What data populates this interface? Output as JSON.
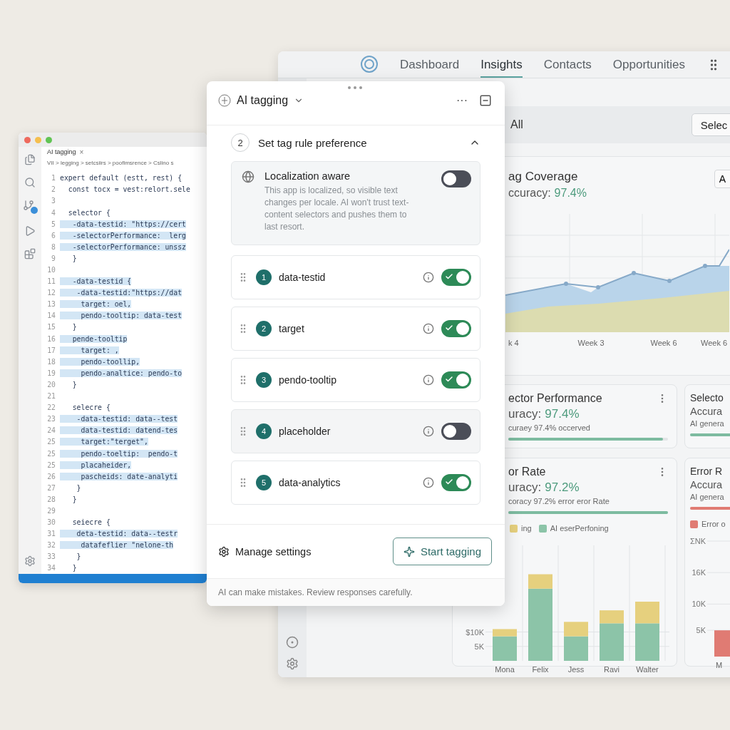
{
  "editor": {
    "tab": "AI tagging",
    "tab_close": "×",
    "breadcrumb": "VII > legging > setcsiirs > poofimsrence > Cslino s",
    "lines": [
      {
        "number": "1",
        "text": "expert default (estt, rest) {",
        "highlighted": false
      },
      {
        "number": "2",
        "text": "  const tocx = vest:relort.sele",
        "highlighted": false
      },
      {
        "number": "3",
        "highlighted": false
      },
      {
        "number": "4",
        "text": "  selector {",
        "highlighted": false
      },
      {
        "number": "5",
        "text": "   -data-testid: \"https://cert",
        "highlighted": true
      },
      {
        "number": "6",
        "text": "   -selectorPerformance:  lerg",
        "highlighted": true
      },
      {
        "number": "8",
        "text": "   -selectorPerformance: unssz",
        "highlighted": true
      },
      {
        "number": "9",
        "text": "   }",
        "highlighted": false
      },
      {
        "number": "10",
        "highlighted": false
      },
      {
        "number": "11",
        "text": "   -data-testid {",
        "highlighted": true
      },
      {
        "number": "12",
        "text": "    -data-testid:\"https://dat",
        "highlighted": true
      },
      {
        "number": "13",
        "text": "     target: oel,",
        "highlighted": true
      },
      {
        "number": "14",
        "text": "     pendo-tooltip: data-test",
        "highlighted": true
      },
      {
        "number": "15",
        "text": "   }",
        "highlighted": false
      },
      {
        "number": "16",
        "text": "   pende-tooltip",
        "highlighted": true
      },
      {
        "number": "17",
        "text": "     target: ,",
        "highlighted": true
      },
      {
        "number": "18",
        "text": "     pendo-toollip,",
        "highlighted": true
      },
      {
        "number": "19",
        "text": "     pendo-analtice: pendo-to",
        "highlighted": true
      },
      {
        "number": "20",
        "text": "   }",
        "highlighted": false
      },
      {
        "number": "21",
        "highlighted": false
      },
      {
        "number": "22",
        "text": "   selecre {",
        "highlighted": false
      },
      {
        "number": "23",
        "text": "    -data-testid: data--test",
        "highlighted": true
      },
      {
        "number": "24",
        "text": "     data-testid: datend-tes",
        "highlighted": true
      },
      {
        "number": "25",
        "text": "     target:\"terget\",",
        "highlighted": true
      },
      {
        "number": "25",
        "text": "     pendo-toeltip:  pendo-t",
        "highlighted": true
      },
      {
        "number": "25",
        "text": "     placaheider,",
        "highlighted": true
      },
      {
        "number": "26",
        "text": "     pascheids: date-analyti",
        "highlighted": true
      },
      {
        "number": "27",
        "text": "    }",
        "highlighted": false
      },
      {
        "number": "28",
        "text": "   }",
        "highlighted": false
      },
      {
        "number": "29",
        "highlighted": false
      },
      {
        "number": "30",
        "text": "   seiecre {",
        "highlighted": false
      },
      {
        "number": "31",
        "text": "    deta-testid: data--testr",
        "highlighted": true
      },
      {
        "number": "32",
        "text": "     datafeflier \"nelone-th",
        "highlighted": true
      },
      {
        "number": "33",
        "text": "    }",
        "highlighted": false
      },
      {
        "number": "34",
        "text": "   }",
        "highlighted": false
      }
    ]
  },
  "dashboard": {
    "tabs": [
      {
        "label": "Dashboard",
        "selected": false
      },
      {
        "label": "Insights",
        "selected": true
      },
      {
        "label": "Contacts",
        "selected": false
      },
      {
        "label": "Opportunities",
        "selected": false
      }
    ],
    "filter": {
      "label": "All",
      "select_button": "Selec"
    },
    "coverage": {
      "title": "ag Coverage",
      "accuracy_label": "ccuracy:",
      "accuracy_value": "97.4%",
      "range_button": "A",
      "x_labels": [
        "k 4",
        "Week 3",
        "Week 6",
        "Week 6"
      ]
    },
    "cards": [
      {
        "kind": "metric",
        "title": "ector Performance",
        "accuracy_label": "uracy:",
        "accuracy_value": "97.4%",
        "note": "curaey 97.4% occerved",
        "level": 0.97,
        "color": "#7dbba0",
        "menu": true
      },
      {
        "kind": "metric",
        "title": "Selecto",
        "accuracy_label": "Accura",
        "note": "AI genera",
        "level": 1,
        "color": "#7dbba0"
      },
      {
        "kind": "chart",
        "title": "or Rate",
        "accuracy_label": "uracy:",
        "accuracy_value": "97.2%",
        "note": "coracy 97.2% error eror Rate",
        "level": 1,
        "color": "#7dbba0",
        "menu": true,
        "chart_data": {
          "type": "bar",
          "stacked": true,
          "grid": true,
          "categories": [
            "Mona",
            "Felix",
            "Jess",
            "Ravi",
            "Walter"
          ],
          "ylim": [
            0,
            40
          ],
          "yticks": [
            {
              "value": 5,
              "label": "5K"
            },
            {
              "value": 10,
              "label": "$10K"
            }
          ],
          "series": [
            {
              "name": "AI eserPerfoning",
              "color": "#8cc4a8",
              "values": [
                8.5,
                25,
                8.5,
                13,
                13
              ]
            },
            {
              "name": "ing",
              "color": "#e6d07e",
              "values": [
                2.5,
                5,
                5,
                4.5,
                7.5
              ]
            }
          ]
        }
      },
      {
        "kind": "chart",
        "title": "Error R",
        "accuracy_label": "Accura",
        "note": "AI genera",
        "level": 1,
        "color": "#e07b73",
        "chart_data": {
          "type": "bar",
          "grid": true,
          "categories": [
            "M"
          ],
          "ylim": [
            0,
            22
          ],
          "yticks": [
            {
              "value": 5,
              "label": "5K"
            },
            {
              "value": 10,
              "label": "10K"
            },
            {
              "value": 16,
              "label": "16K"
            },
            {
              "value": 22,
              "label": "ΣNK"
            }
          ],
          "series": [
            {
              "name": "Error o",
              "color": "#e07b73",
              "values": [
                5
              ]
            }
          ]
        }
      }
    ]
  },
  "panel": {
    "title": "AI tagging",
    "more": "···",
    "step": {
      "number": "2",
      "title": "Set tag rule preference",
      "expanded": true
    },
    "localization": {
      "title": "Localization aware",
      "description": "This app is localized, so visible text changes per locale. AI won't trust text-content selectors and pushes them to last resort.",
      "on": false
    },
    "rules": [
      {
        "number": "1",
        "name": "data-testid",
        "on": true
      },
      {
        "number": "2",
        "name": "target",
        "on": true
      },
      {
        "number": "3",
        "name": "pendo-tooltip",
        "on": true
      },
      {
        "number": "4",
        "name": "placeholder",
        "on": false
      },
      {
        "number": "5",
        "name": "data-analytics",
        "on": true
      }
    ],
    "manage": "Manage settings",
    "start_button": "Start tagging",
    "disclaimer": "AI can make mistakes. Review responses carefully."
  }
}
